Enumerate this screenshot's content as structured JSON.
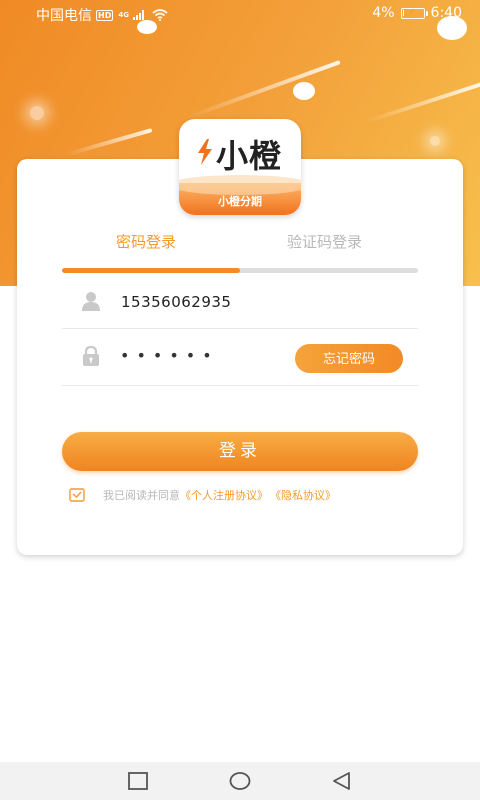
{
  "status_bar": {
    "carrier": "中国电信",
    "hd_badge": "HD",
    "network": "4G",
    "battery_percent": "4%",
    "battery_level": 0.04,
    "time": "6:40"
  },
  "logo": {
    "brand_name": "小橙",
    "band_label": "小橙分期"
  },
  "tabs": {
    "password_login": "密码登录",
    "sms_login": "验证码登录",
    "active_index": 0
  },
  "form": {
    "phone_value": "15356062935",
    "password_mask": "••••••",
    "forgot_label": "忘记密码",
    "login_label": "登录"
  },
  "agreement": {
    "prefix": "我已阅读并同意",
    "user_agreement": "《个人注册协议》",
    "privacy_policy": "《隐私协议》"
  },
  "icons": {
    "phone_field": "user-icon",
    "password_field": "lock-icon",
    "agree": "checkbox-icon",
    "nav_recent": "square-icon",
    "nav_home": "circle-icon",
    "nav_back": "triangle-back-icon"
  },
  "colors": {
    "accent": "#f38a25",
    "tab_active": "#f39a30",
    "muted_text": "#b8b8b8"
  }
}
